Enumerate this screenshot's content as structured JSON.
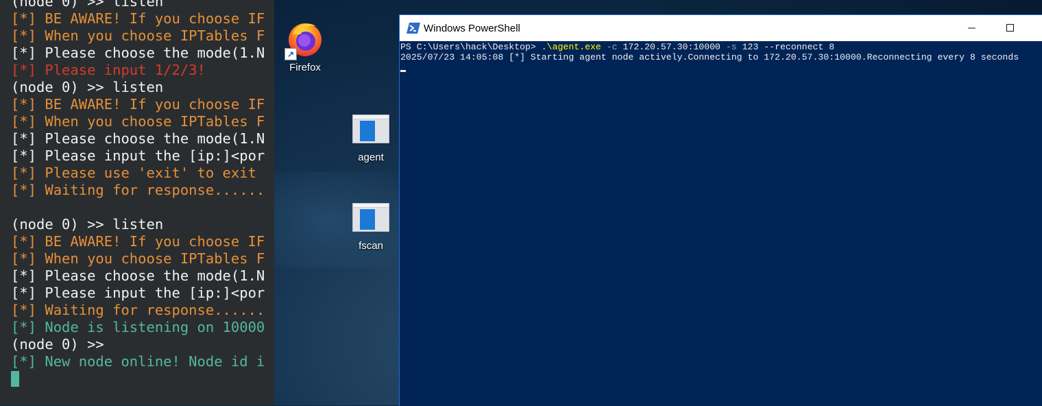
{
  "left_terminal": {
    "lines": [
      {
        "text": "(node 0) >> listen",
        "color": "#f2f2f2"
      },
      {
        "text": "[*] BE AWARE! If you choose IF",
        "color": "#e5903a"
      },
      {
        "text": "[*] When you choose IPTables F",
        "color": "#e5903a"
      },
      {
        "text": "[*] Please choose the mode(1.N",
        "color": "#f2f2f2"
      },
      {
        "text": "[*] Please input 1/2/3!",
        "color": "#d23b2c"
      },
      {
        "text": "(node 0) >> listen",
        "color": "#f2f2f2"
      },
      {
        "text": "[*] BE AWARE! If you choose IF",
        "color": "#e5903a"
      },
      {
        "text": "[*] When you choose IPTables F",
        "color": "#e5903a"
      },
      {
        "text": "[*] Please choose the mode(1.N",
        "color": "#f2f2f2"
      },
      {
        "text": "[*] Please input the [ip:]<por",
        "color": "#f2f2f2"
      },
      {
        "text": "[*] Please use 'exit' to exit",
        "color": "#e5903a"
      },
      {
        "text": "[*] Waiting for response......",
        "color": "#e5903a"
      },
      {
        "text": "",
        "color": "#f2f2f2"
      },
      {
        "text": "(node 0) >> listen",
        "color": "#f2f2f2"
      },
      {
        "text": "[*] BE AWARE! If you choose IF",
        "color": "#e5903a"
      },
      {
        "text": "[*] When you choose IPTables F",
        "color": "#e5903a"
      },
      {
        "text": "[*] Please choose the mode(1.N",
        "color": "#f2f2f2"
      },
      {
        "text": "[*] Please input the [ip:]<por",
        "color": "#f2f2f2"
      },
      {
        "text": "[*] Waiting for response......",
        "color": "#e5903a"
      },
      {
        "text": "[*] Node is listening on 10000",
        "color": "#53b8a0"
      },
      {
        "text": "(node 0) >>",
        "color": "#f2f2f2"
      },
      {
        "text": "[*] New node online! Node id i",
        "color": "#53b8a0"
      }
    ]
  },
  "desktop_icons": {
    "firefox": {
      "label": "Firefox",
      "icon": "firefox-icon"
    },
    "agent": {
      "label": "agent",
      "icon": "file-icon"
    },
    "fscan": {
      "label": "fscan",
      "icon": "file-icon"
    }
  },
  "powershell": {
    "title": "Windows PowerShell",
    "prompt": "PS C:\\Users\\hack\\Desktop> ",
    "command_exe": ".\\agent.exe",
    "arg_c_flag": " -c",
    "arg_c_value": " 172.20.57.30:10000",
    "arg_s_flag": " -s",
    "arg_s_value": " 123 --reconnect 8",
    "output_line": "2025/07/23 14:05:08 [*] Starting agent node actively.Connecting to 172.20.57.30:10000.Reconnecting every 8 seconds",
    "colors": {
      "background": "#012456",
      "text": "#eeedf0",
      "exe": "#ffff00",
      "flag": "#9aa4b4"
    }
  }
}
